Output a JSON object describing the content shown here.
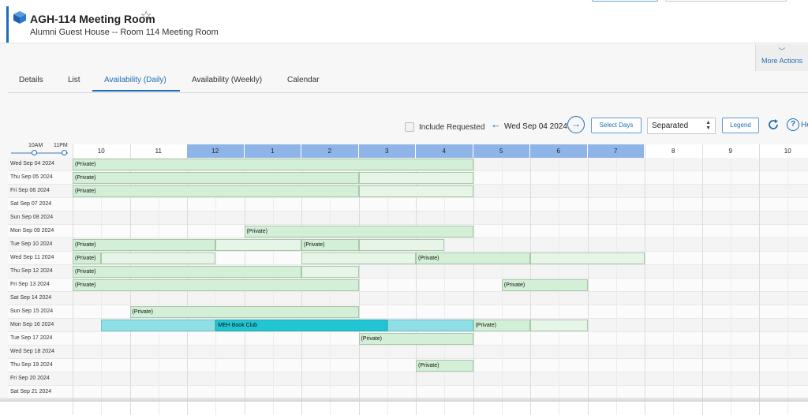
{
  "header": {
    "title": "AGH-114 Meeting Room",
    "subtitle": "Alumni Guest House -- Room 114 Meeting Room",
    "more_actions": "More Actions"
  },
  "tabs": [
    {
      "label": "Details",
      "active": false
    },
    {
      "label": "List",
      "active": false
    },
    {
      "label": "Availability (Daily)",
      "active": true
    },
    {
      "label": "Availability (Weekly)",
      "active": false
    },
    {
      "label": "Calendar",
      "active": false
    }
  ],
  "toolbar": {
    "include_requested": "Include Requested",
    "date": "Wed Sep 04 2024",
    "select_days": "Select Days",
    "view_mode": "Separated",
    "legend": "Legend",
    "help": "He"
  },
  "range": {
    "from": "10AM",
    "to": "11PM"
  },
  "hours": [
    "10",
    "11",
    "12",
    "1",
    "2",
    "3",
    "4",
    "5",
    "6",
    "7",
    "8",
    "9",
    "10"
  ],
  "days": [
    "Wed Sep 04 2024",
    "Thu Sep 05 2024",
    "Fri Sep 06 2024",
    "Sat Sep 07 2024",
    "Sun Sep 08 2024",
    "Mon Sep 09 2024",
    "Tue Sep 10 2024",
    "Wed Sep 11 2024",
    "Thu Sep 12 2024",
    "Fri Sep 13 2024",
    "Sat Sep 14 2024",
    "Sun Sep 15 2024",
    "Mon Sep 16 2024",
    "Tue Sep 17 2024",
    "Wed Sep 18 2024",
    "Thu Sep 19 2024",
    "Fri Sep 20 2024",
    "Sat Sep 21 2024"
  ],
  "bookings": [
    {
      "day": 0,
      "start": 10.0,
      "end": 17.0,
      "label": "(Private)",
      "style": "green"
    },
    {
      "day": 1,
      "start": 10.0,
      "end": 15.0,
      "label": "(Private)",
      "style": "green"
    },
    {
      "day": 1,
      "start": 15.0,
      "end": 17.0,
      "label": "",
      "style": "light"
    },
    {
      "day": 2,
      "start": 10.0,
      "end": 15.0,
      "label": "(Private)",
      "style": "green"
    },
    {
      "day": 2,
      "start": 15.0,
      "end": 17.0,
      "label": "",
      "style": "light"
    },
    {
      "day": 5,
      "start": 13.0,
      "end": 17.0,
      "label": "(Private)",
      "style": "green"
    },
    {
      "day": 6,
      "start": 10.0,
      "end": 12.5,
      "label": "(Private)",
      "style": "green"
    },
    {
      "day": 6,
      "start": 12.5,
      "end": 14.0,
      "label": "",
      "style": "light"
    },
    {
      "day": 6,
      "start": 14.0,
      "end": 15.0,
      "label": "(Private)",
      "style": "green"
    },
    {
      "day": 6,
      "start": 15.0,
      "end": 16.5,
      "label": "",
      "style": "light"
    },
    {
      "day": 7,
      "start": 10.0,
      "end": 10.5,
      "label": "(Private)",
      "style": "green"
    },
    {
      "day": 7,
      "start": 10.5,
      "end": 12.5,
      "label": "",
      "style": "light"
    },
    {
      "day": 7,
      "start": 14.0,
      "end": 16.0,
      "label": "",
      "style": "light"
    },
    {
      "day": 7,
      "start": 16.0,
      "end": 18.0,
      "label": "(Private)",
      "style": "green"
    },
    {
      "day": 7,
      "start": 18.0,
      "end": 20.0,
      "label": "",
      "style": "light"
    },
    {
      "day": 8,
      "start": 10.0,
      "end": 14.0,
      "label": "(Private)",
      "style": "green"
    },
    {
      "day": 8,
      "start": 14.0,
      "end": 15.0,
      "label": "",
      "style": "light"
    },
    {
      "day": 9,
      "start": 10.0,
      "end": 15.0,
      "label": "(Private)",
      "style": "green"
    },
    {
      "day": 9,
      "start": 17.5,
      "end": 19.0,
      "label": "(Private)",
      "style": "green"
    },
    {
      "day": 11,
      "start": 11.0,
      "end": 15.0,
      "label": "(Private)",
      "style": "green"
    },
    {
      "day": 12,
      "start": 10.5,
      "end": 12.5,
      "label": "",
      "style": "cyan"
    },
    {
      "day": 12,
      "start": 12.5,
      "end": 15.5,
      "label": "MEH Book Club",
      "style": "cyan2"
    },
    {
      "day": 12,
      "start": 15.5,
      "end": 17.0,
      "label": "",
      "style": "cyan"
    },
    {
      "day": 12,
      "start": 17.0,
      "end": 18.0,
      "label": "(Private)",
      "style": "green"
    },
    {
      "day": 12,
      "start": 18.0,
      "end": 19.0,
      "label": "",
      "style": "light"
    },
    {
      "day": 13,
      "start": 15.0,
      "end": 17.0,
      "label": "(Private)",
      "style": "green"
    },
    {
      "day": 15,
      "start": 16.0,
      "end": 17.0,
      "label": "(Private)",
      "style": "green"
    }
  ],
  "colors": {
    "accent": "#1f6eb5",
    "hour_header_highlight": "#8fb4e8",
    "booking_green": "#d4efd7",
    "booking_light": "#e6f5e8",
    "booking_cyan": "#8fdfe6",
    "booking_cyan_dark": "#22c5d3"
  }
}
